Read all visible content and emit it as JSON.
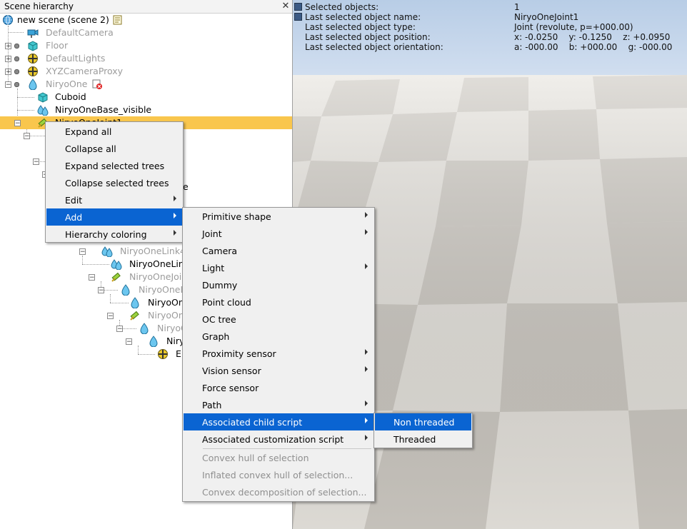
{
  "hierarchy": {
    "title": "Scene hierarchy",
    "close": "✕",
    "root": "new scene (scene 2)",
    "items": [
      "DefaultCamera",
      "Floor",
      "DefaultLights",
      "XYZCameraProxy",
      "NiryoOne",
      "Cuboid",
      "NiryoOneBase_visible",
      "NiryoOneJoint1"
    ],
    "partial": [
      "e",
      "NiryoOneLink4",
      "NiryoOneLin",
      "NiryoOneJoi",
      "NiryoOneL",
      "NiryoOn",
      "NiryoOn",
      "NiryoO",
      "Niry",
      "E"
    ]
  },
  "info": {
    "selected_objects_label": "Selected objects:",
    "selected_objects_value": "1",
    "name_label": "Last selected object name:",
    "name_value": "NiryoOneJoint1",
    "type_label": "Last selected object type:",
    "type_value": "Joint (revolute, p=+000.00)",
    "position_label": "Last selected object position:",
    "position_value": "x: -0.0250    y: -0.1250    z: +0.0950",
    "orientation_label": "Last selected object orientation:",
    "orientation_value": "a: -000.00    b: +000.00    g: -000.00"
  },
  "menu1": [
    "Expand all",
    "Collapse all",
    "Expand selected trees",
    "Collapse selected trees",
    "Edit",
    "Add",
    "Hierarchy coloring"
  ],
  "menu2": [
    "Primitive shape",
    "Joint",
    "Camera",
    "Light",
    "Dummy",
    "Point cloud",
    "OC tree",
    "Graph",
    "Proximity sensor",
    "Vision sensor",
    "Force sensor",
    "Path",
    "Associated child script",
    "Associated customization script",
    "Convex hull of selection",
    "Inflated convex hull of selection...",
    "Convex decomposition of selection..."
  ],
  "menu3": [
    "Non threaded",
    "Threaded"
  ],
  "colors": {
    "selection_row": "#f9c64d",
    "menu_highlight": "#0a64d2"
  }
}
